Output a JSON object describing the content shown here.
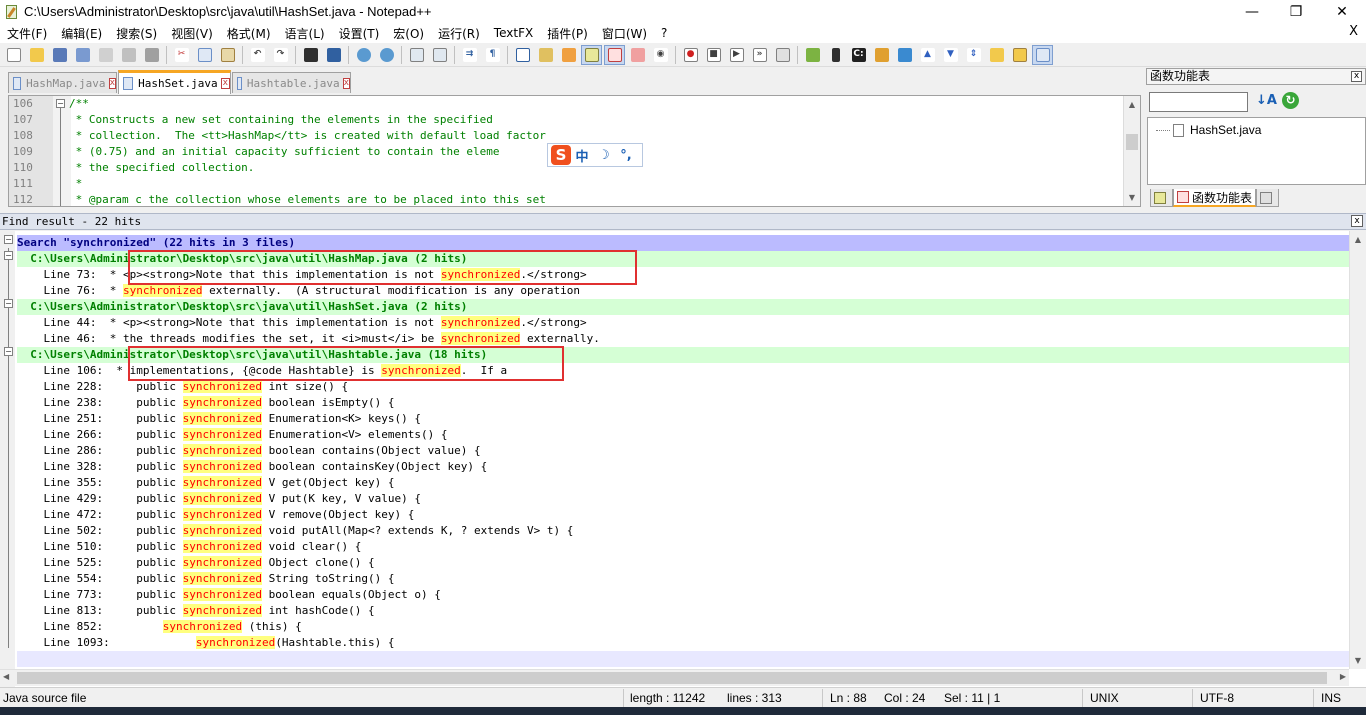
{
  "window": {
    "title": "C:\\Users\\Administrator\\Desktop\\src\\java\\util\\HashSet.java - Notepad++",
    "minimize": "—",
    "restore": "❐",
    "close": "✕"
  },
  "menu": {
    "items": [
      "文件(F)",
      "编辑(E)",
      "搜索(S)",
      "视图(V)",
      "格式(M)",
      "语言(L)",
      "设置(T)",
      "宏(O)",
      "运行(R)",
      "TextFX",
      "插件(P)",
      "窗口(W)",
      "?"
    ],
    "close": "X"
  },
  "toolbar": {
    "icons": [
      "new-file-icon",
      "open-file-icon",
      "save-icon",
      "save-all-icon",
      "close-icon",
      "close-all-icon",
      "print-icon",
      "cut-icon",
      "copy-icon",
      "paste-icon",
      "undo-icon",
      "redo-icon",
      "find-icon",
      "replace-icon",
      "zoom-in-icon",
      "zoom-out-icon",
      "sync-vertical-icon",
      "sync-horizontal-icon",
      "word-wrap-icon",
      "show-all-chars-icon",
      "indent-guide-icon",
      "udl-icon",
      "doc-map-icon",
      "function-list-icon",
      "folder-workspace-icon",
      "monitor-icon",
      "record-macro-icon",
      "stop-record-icon",
      "play-macro-icon",
      "run-macro-multiple-icon",
      "save-macro-icon",
      "android-icon",
      "phone-icon",
      "console-icon",
      "plugin-icon",
      "translate-icon",
      "arrow-up-icon",
      "arrow-down-icon",
      "compare-icon",
      "folder-open-icon",
      "file-browser-icon",
      "panel-icon"
    ]
  },
  "tabs": [
    {
      "label": "HashMap.java",
      "active": false
    },
    {
      "label": "HashSet.java",
      "active": true
    },
    {
      "label": "Hashtable.java",
      "active": false
    }
  ],
  "editor": {
    "lines": [
      {
        "num": "106",
        "code": "/**"
      },
      {
        "num": "107",
        "code": " * Constructs a new set containing the elements in the specified"
      },
      {
        "num": "108",
        "code": " * collection.  The <tt>HashMap</tt> is created with default load factor"
      },
      {
        "num": "109",
        "code": " * (0.75) and an initial capacity sufficient to contain the eleme"
      },
      {
        "num": "110",
        "code": " * the specified collection."
      },
      {
        "num": "111",
        "code": " *"
      },
      {
        "num": "112",
        "code": " * @param c the collection whose elements are to be placed into this set"
      }
    ]
  },
  "ime": {
    "logo": "S",
    "lang": "中",
    "moon": "☽",
    "punct": "°,"
  },
  "function_panel": {
    "title": "函数功能表",
    "close": "x",
    "sort_icon": "↓A",
    "refresh_icon": "↻",
    "tree_item": "HashSet.java",
    "tab_label": "函数功能表"
  },
  "find_result": {
    "header": "Find result - 22 hits",
    "close": "x",
    "search_line": "Search \"synchronized\" (22 hits in 3 files)",
    "files": [
      {
        "path": "  C:\\Users\\Administrator\\Desktop\\src\\java\\util\\HashMap.java (2 hits)",
        "hits": [
          {
            "prefix": "\tLine 73: ",
            "before": " * <p><strong>Note that this implementation is not ",
            "match": "synchronized",
            "after": ".</strong>"
          },
          {
            "prefix": "\tLine 76: ",
            "before": " * ",
            "match": "synchronized",
            "after": " externally.  (A structural modification is any operation"
          }
        ]
      },
      {
        "path": "  C:\\Users\\Administrator\\Desktop\\src\\java\\util\\HashSet.java (2 hits)",
        "hits": [
          {
            "prefix": "\tLine 44: ",
            "before": " * <p><strong>Note that this implementation is not ",
            "match": "synchronized",
            "after": ".</strong>"
          },
          {
            "prefix": "\tLine 46: ",
            "before": " * the threads modifies the set, it <i>must</i> be ",
            "match": "synchronized",
            "after": " externally."
          }
        ]
      },
      {
        "path": "  C:\\Users\\Administrator\\Desktop\\src\\java\\util\\Hashtable.java (18 hits)",
        "hits": [
          {
            "prefix": "\tLine 106: ",
            "before": " * implementations, {@code Hashtable} is ",
            "match": "synchronized",
            "after": ".  If a"
          },
          {
            "prefix": "\tLine 228: ",
            "before": "    public ",
            "match": "synchronized",
            "after": " int size() {"
          },
          {
            "prefix": "\tLine 238: ",
            "before": "    public ",
            "match": "synchronized",
            "after": " boolean isEmpty() {"
          },
          {
            "prefix": "\tLine 251: ",
            "before": "    public ",
            "match": "synchronized",
            "after": " Enumeration<K> keys() {"
          },
          {
            "prefix": "\tLine 266: ",
            "before": "    public ",
            "match": "synchronized",
            "after": " Enumeration<V> elements() {"
          },
          {
            "prefix": "\tLine 286: ",
            "before": "    public ",
            "match": "synchronized",
            "after": " boolean contains(Object value) {"
          },
          {
            "prefix": "\tLine 328: ",
            "before": "    public ",
            "match": "synchronized",
            "after": " boolean containsKey(Object key) {"
          },
          {
            "prefix": "\tLine 355: ",
            "before": "    public ",
            "match": "synchronized",
            "after": " V get(Object key) {"
          },
          {
            "prefix": "\tLine 429: ",
            "before": "    public ",
            "match": "synchronized",
            "after": " V put(K key, V value) {"
          },
          {
            "prefix": "\tLine 472: ",
            "before": "    public ",
            "match": "synchronized",
            "after": " V remove(Object key) {"
          },
          {
            "prefix": "\tLine 502: ",
            "before": "    public ",
            "match": "synchronized",
            "after": " void putAll(Map<? extends K, ? extends V> t) {"
          },
          {
            "prefix": "\tLine 510: ",
            "before": "    public ",
            "match": "synchronized",
            "after": " void clear() {"
          },
          {
            "prefix": "\tLine 525: ",
            "before": "    public ",
            "match": "synchronized",
            "after": " Object clone() {"
          },
          {
            "prefix": "\tLine 554: ",
            "before": "    public ",
            "match": "synchronized",
            "after": " String toString() {"
          },
          {
            "prefix": "\tLine 773: ",
            "before": "    public ",
            "match": "synchronized",
            "after": " boolean equals(Object o) {"
          },
          {
            "prefix": "\tLine 813: ",
            "before": "    public ",
            "match": "synchronized",
            "after": " int hashCode() {"
          },
          {
            "prefix": "\tLine 852: ",
            "before": "        ",
            "match": "synchronized",
            "after": " (this) {"
          },
          {
            "prefix": "\tLine 1093: ",
            "before": "            ",
            "match": "synchronized",
            "after": "(Hashtable.this) {"
          }
        ]
      }
    ]
  },
  "status": {
    "file_type": "Java source file",
    "length": "length : 11242",
    "lines": "lines : 313",
    "ln": "Ln : 88",
    "col": "Col : 24",
    "sel": "Sel : 11 | 1",
    "eol": "UNIX",
    "encoding": "UTF-8",
    "mode": "INS"
  },
  "colors": {
    "search_header_bg": "#bbbbff",
    "file_header_bg": "#d5ffd5",
    "match_bg": "#ffff7f",
    "match_fg": "#ff0000",
    "annotation_box": "#e03030",
    "active_tab_accent": "#f6a623",
    "comment_green": "#008000"
  }
}
